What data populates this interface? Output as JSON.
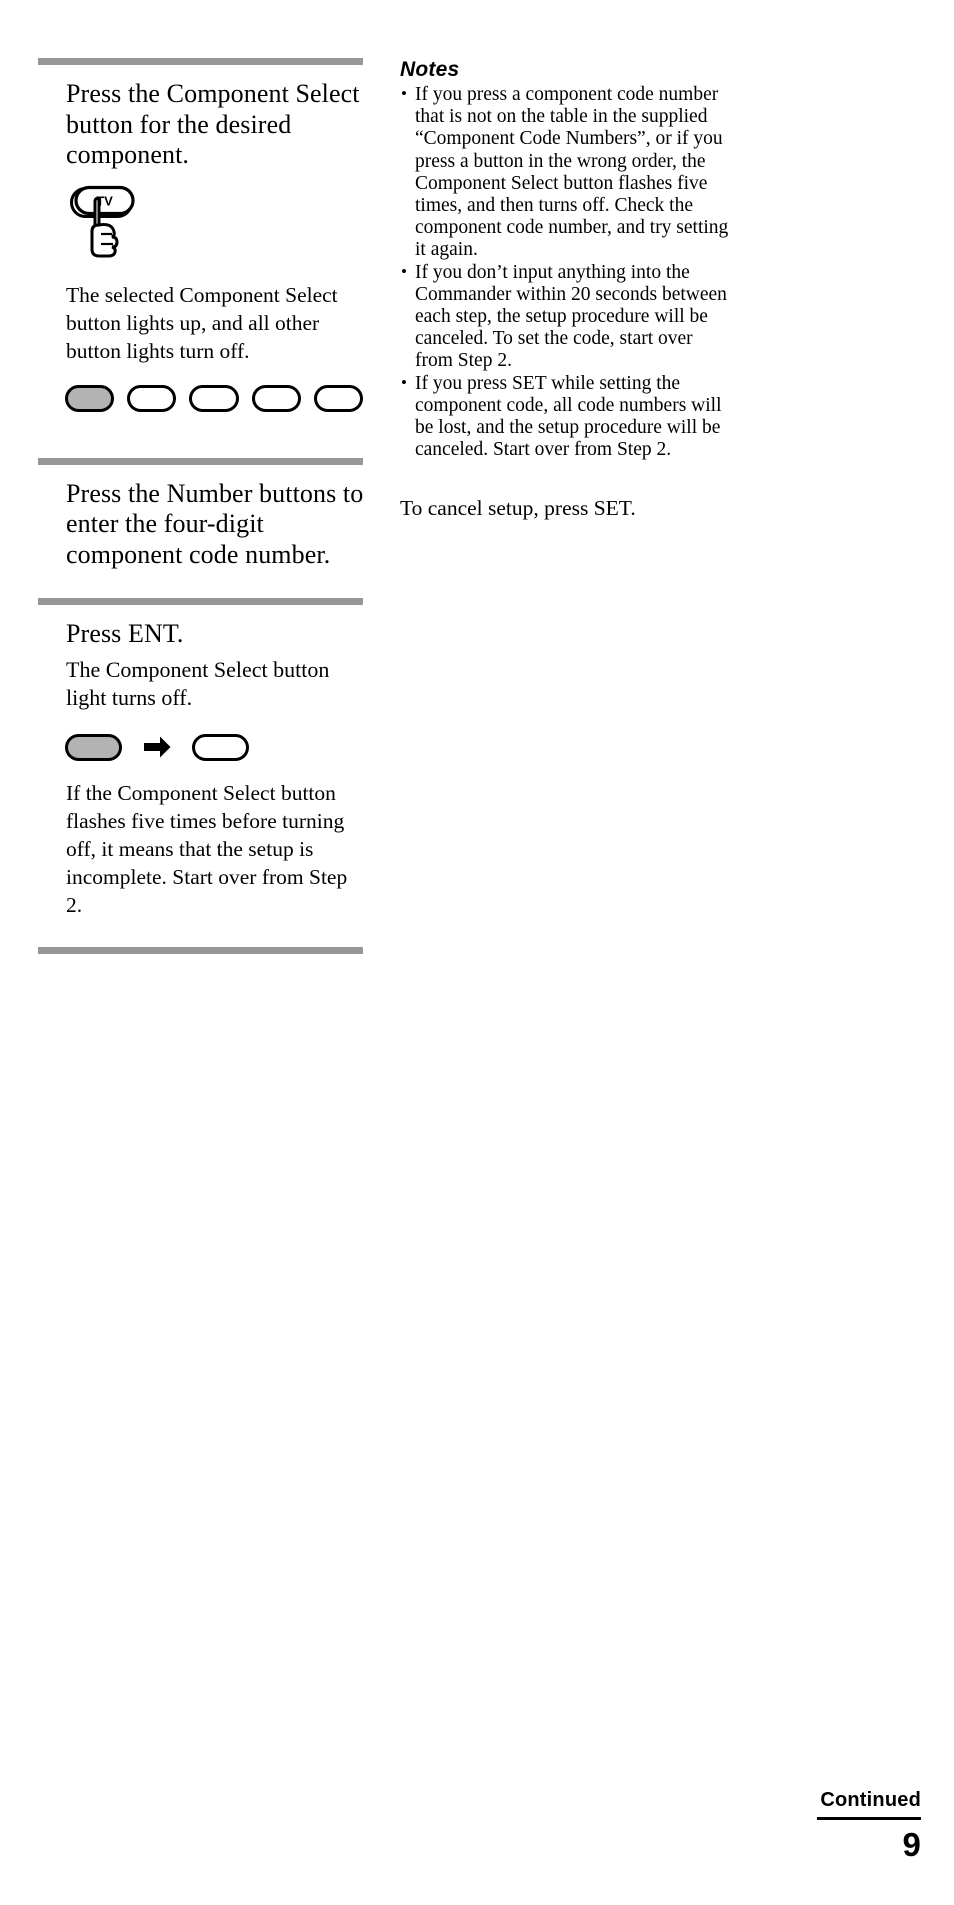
{
  "document": {
    "page_number": "9",
    "continued_label": "Continued"
  },
  "steps": [
    {
      "id": "step-component-select",
      "heading": "Press the Component Select button for the desired component.",
      "figure_label": "TV",
      "body": "The selected Component Select button lights up, and all other button lights turn off.",
      "buttons": [
        {
          "state": "lit"
        },
        {
          "state": "off"
        },
        {
          "state": "off"
        },
        {
          "state": "off"
        },
        {
          "state": "off"
        }
      ]
    },
    {
      "id": "step-number-buttons",
      "heading": "Press the Number buttons to enter the four-digit component code number."
    },
    {
      "id": "step-ent",
      "heading": "Press ENT.",
      "body": "The Component Select button light turns off.",
      "sequence": [
        {
          "state": "lit"
        },
        {
          "state": "arrow"
        },
        {
          "state": "off"
        }
      ],
      "note": "If the Component Select button flashes five times before turning off, it means that the setup is incomplete. Start over from Step 2."
    }
  ],
  "notes": {
    "title": "Notes",
    "items": [
      "If you press a component code number that is not on the table in the supplied “Component Code Numbers”, or if you press a button in the wrong order, the Component Select button flashes five times, and then turns off. Check the component code number, and try setting it again.",
      "If you don’t input anything into the Commander within 20 seconds between each step, the setup procedure will be canceled. To set the code, start over from Step 2.",
      "If you press SET while setting the component code, all code numbers will be lost, and the setup procedure will be canceled. Start over from Step 2."
    ],
    "cancel_text": "To cancel setup, press SET."
  },
  "colors": {
    "rule_gray": "#969696",
    "button_lit": "#b3b3b3",
    "ink": "#000000"
  }
}
